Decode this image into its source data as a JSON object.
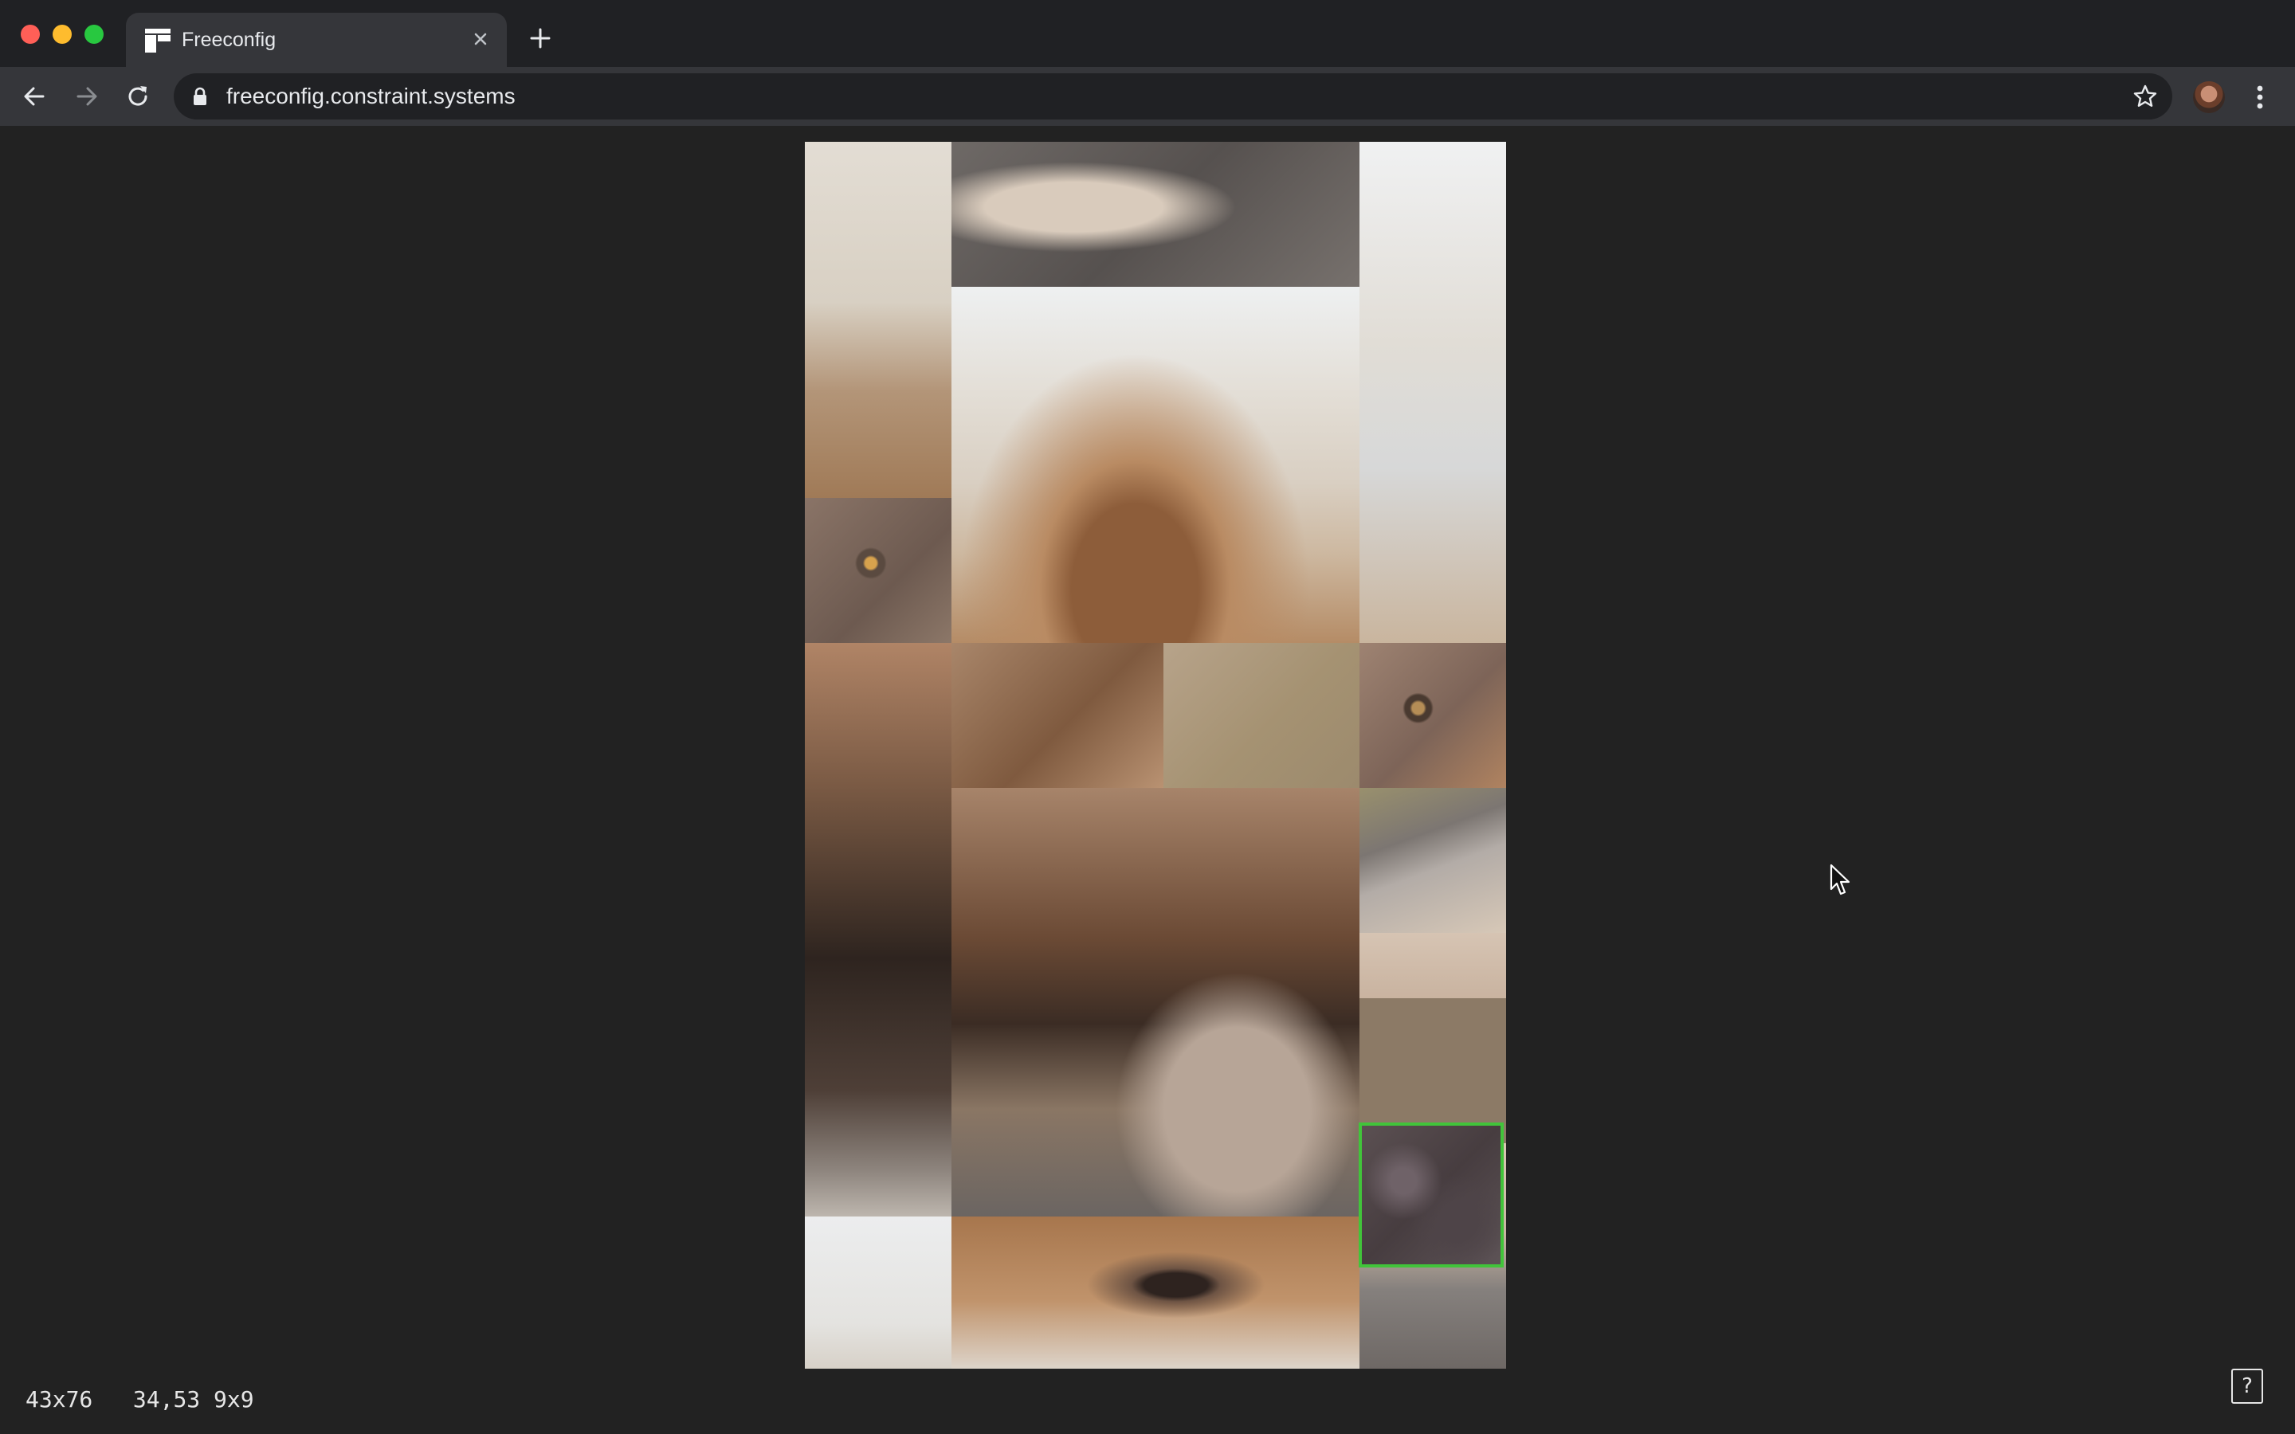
{
  "browser": {
    "tab_title": "Freeconfig",
    "url": "freeconfig.constraint.systems"
  },
  "status": {
    "size": "43x76",
    "position": "34,53",
    "grid": "9x9"
  },
  "help_label": "?",
  "colors": {
    "selection_border": "#41c43a",
    "page_background": "#222222"
  },
  "icons": [
    "close-icon",
    "plus-icon",
    "back-arrow-icon",
    "forward-arrow-icon",
    "reload-icon",
    "lock-icon",
    "star-icon",
    "more-vert-icon",
    "cursor-icon"
  ]
}
